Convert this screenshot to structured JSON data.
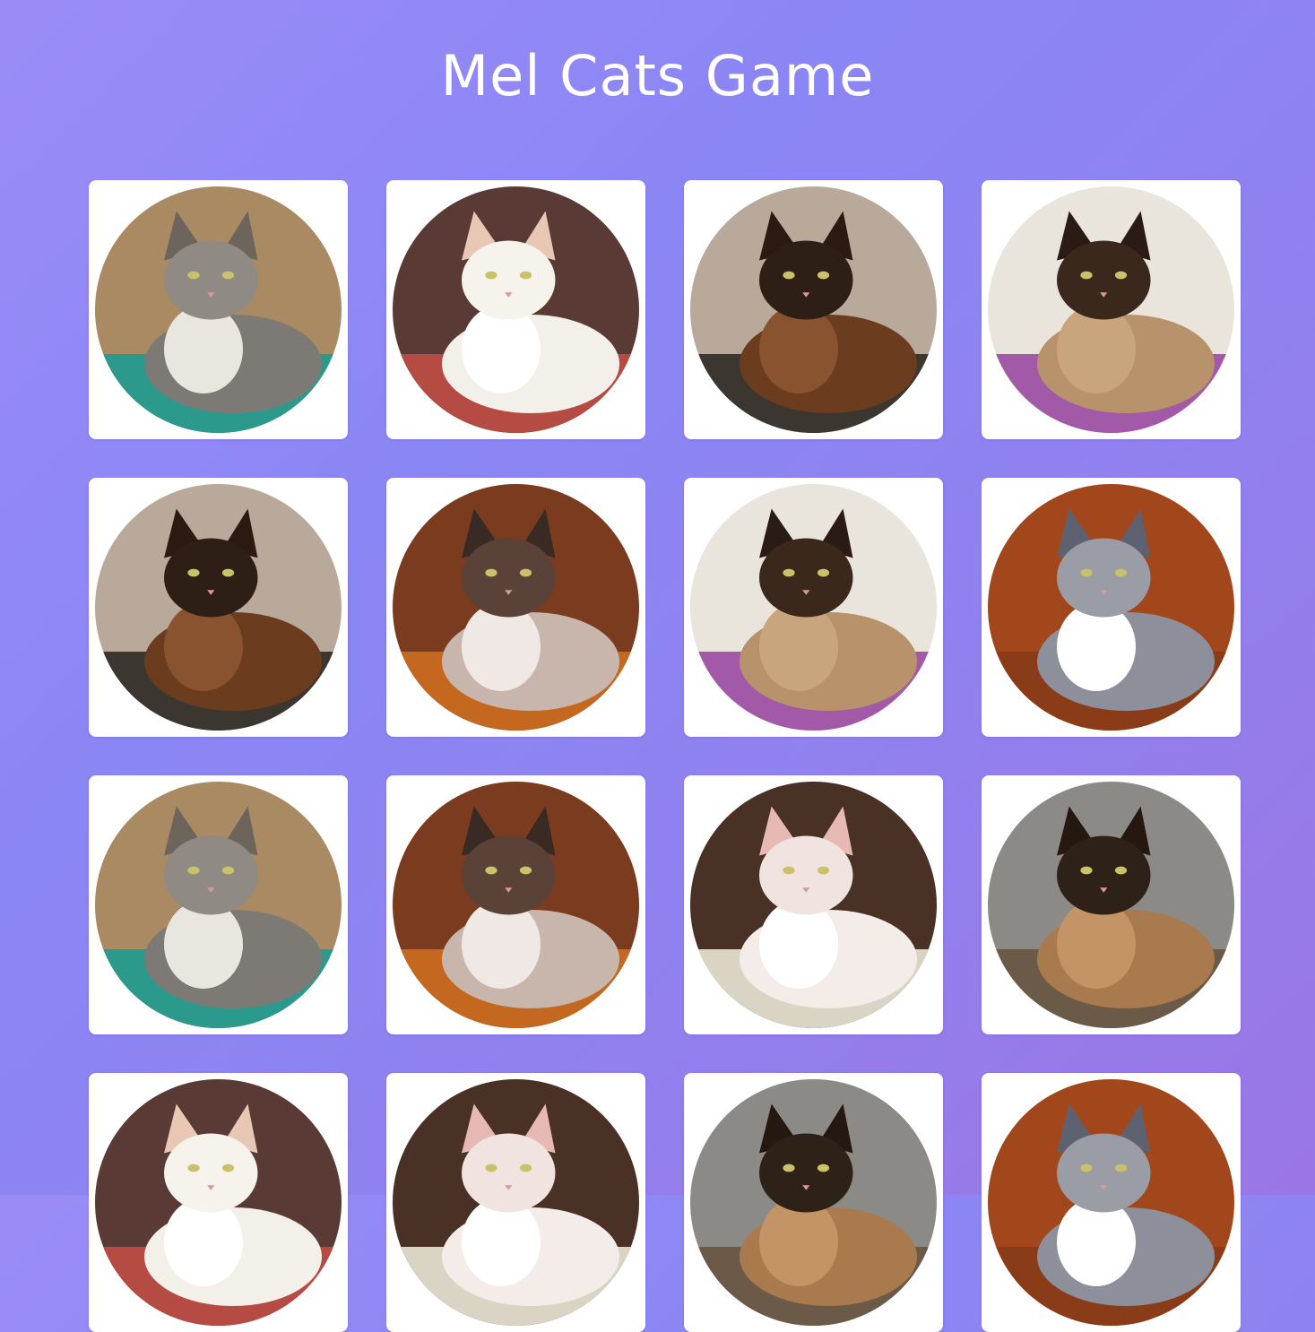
{
  "header": {
    "title": "Mel Cats Game"
  },
  "board": {
    "cards": [
      {
        "cat": "grey-longhair-cat",
        "bg": "#a98a63",
        "floor": "#2b9a8c",
        "body": "#7d7a76",
        "chest": "#e9e6df",
        "ears": "#6d645c",
        "face": "#8f8a83"
      },
      {
        "cat": "white-cat",
        "bg": "#5a3a35",
        "floor": "#b54b42",
        "body": "#f3efe9",
        "chest": "#ffffff",
        "ears": "#e8c8b5",
        "face": "#f6f2ec"
      },
      {
        "cat": "siamese-cat-balcony",
        "bg": "#b8a99b",
        "floor": "#3b3630",
        "body": "#6b3c1e",
        "chest": "#8a5330",
        "ears": "#2a1a12",
        "face": "#2e1f16"
      },
      {
        "cat": "siamese-cat-bed",
        "bg": "#e9e4dc",
        "floor": "#a25aa8",
        "body": "#b8926a",
        "chest": "#c9a57d",
        "ears": "#2a1c14",
        "face": "#3a281c"
      },
      {
        "cat": "siamese-cat-balcony",
        "bg": "#b8a99b",
        "floor": "#3b3630",
        "body": "#6b3c1e",
        "chest": "#8a5330",
        "ears": "#2a1a12",
        "face": "#2e1f16"
      },
      {
        "cat": "blue-eyed-siamese-cat",
        "bg": "#7a3b1f",
        "floor": "#c4681f",
        "body": "#c8b5ab",
        "chest": "#f0e8e4",
        "ears": "#3a2a24",
        "face": "#5a4238"
      },
      {
        "cat": "siamese-cat-bed",
        "bg": "#e9e4dc",
        "floor": "#a25aa8",
        "body": "#b8926a",
        "chest": "#c9a57d",
        "ears": "#2a1c14",
        "face": "#3a281c"
      },
      {
        "cat": "three-cats-floor",
        "bg": "#a2471c",
        "floor": "#8a3c18",
        "body": "#8d8f9a",
        "chest": "#ffffff",
        "ears": "#5e6170",
        "face": "#9a9ca6"
      },
      {
        "cat": "grey-longhair-cat",
        "bg": "#a98a63",
        "floor": "#2b9a8c",
        "body": "#7d7a76",
        "chest": "#e9e6df",
        "ears": "#6d645c",
        "face": "#8f8a83"
      },
      {
        "cat": "blue-eyed-siamese-cat",
        "bg": "#7a3b1f",
        "floor": "#c4681f",
        "body": "#c8b5ab",
        "chest": "#f0e8e4",
        "ears": "#3a2a24",
        "face": "#5a4238"
      },
      {
        "cat": "white-cat-paws",
        "bg": "#4a3126",
        "floor": "#d9d4c4",
        "body": "#f4ece8",
        "chest": "#ffffff",
        "ears": "#e6b9b5",
        "face": "#f1e3df"
      },
      {
        "cat": "siamese-cat-flowers",
        "bg": "#8c8a86",
        "floor": "#6b5a48",
        "body": "#a87a4e",
        "chest": "#c29466",
        "ears": "#241810",
        "face": "#2e2118"
      },
      {
        "cat": "white-cat",
        "bg": "#5a3a35",
        "floor": "#b54b42",
        "body": "#f3efe9",
        "chest": "#ffffff",
        "ears": "#e8c8b5",
        "face": "#f6f2ec"
      },
      {
        "cat": "white-cat-paws",
        "bg": "#4a3126",
        "floor": "#d9d4c4",
        "body": "#f4ece8",
        "chest": "#ffffff",
        "ears": "#e6b9b5",
        "face": "#f1e3df"
      },
      {
        "cat": "siamese-cat-flowers",
        "bg": "#8c8a86",
        "floor": "#6b5a48",
        "body": "#a87a4e",
        "chest": "#c29466",
        "ears": "#241810",
        "face": "#2e2118"
      },
      {
        "cat": "three-cats-floor",
        "bg": "#a2471c",
        "floor": "#8a3c18",
        "body": "#8d8f9a",
        "chest": "#ffffff",
        "ears": "#5e6170",
        "face": "#9a9ca6"
      }
    ]
  }
}
